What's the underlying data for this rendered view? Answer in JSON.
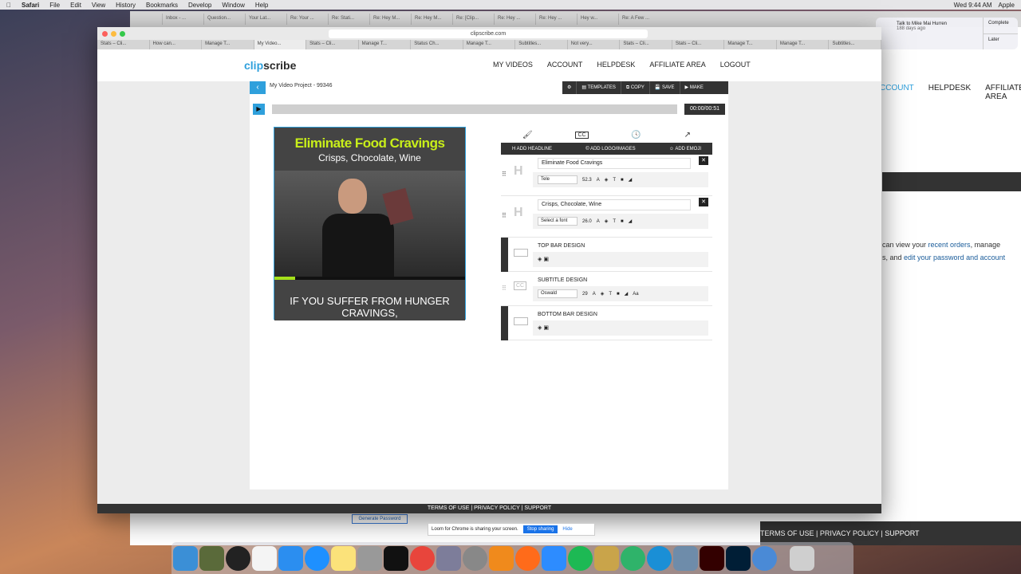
{
  "menubar": {
    "app": "Safari",
    "items": [
      "File",
      "Edit",
      "View",
      "History",
      "Bookmarks",
      "Develop",
      "Window",
      "Help"
    ],
    "clock": "Wed 9:44 AM",
    "user": "Apple"
  },
  "background_window": {
    "tabs": [
      "Inbox - ...",
      "Question...",
      "Your Lat...",
      "Re: Your ...",
      "Re: Stati...",
      "Re: Hey M...",
      "Re: Hey M...",
      "Re: [Clip...",
      "Re: Hey ...",
      "Re: Hey ...",
      "Hey w...",
      "Re: A Few ..."
    ],
    "nav": [
      "CCOUNT",
      "HELPDESK",
      "AFFILIATE AREA"
    ],
    "text_line1_pre": "can view your ",
    "text_line1_link": "recent orders",
    "text_line1_post": ", manage",
    "text_line2_pre": "s, and ",
    "text_line2_link": "edit your password and account",
    "footer": "TERMS OF USE | PRIVACY POLICY | SUPPORT",
    "generate_password": "Generate Password"
  },
  "notification": {
    "title": "Talk to Mike Mai Hurren",
    "subtitle": "188 days ago",
    "complete": "Complete",
    "later": "Later"
  },
  "browser": {
    "url": "clipscribe.com",
    "tabs": [
      "Stats – Cli...",
      "How can...",
      "Manage T...",
      "My Video...",
      "Stats – Cli...",
      "Manage T...",
      "Status Ch...",
      "Manage T...",
      "Subtitles...",
      "Not very...",
      "Stats – Cli...",
      "Stats – Cli...",
      "Manage T...",
      "Manage T...",
      "Subtitles..."
    ]
  },
  "site": {
    "logo_a": "clip",
    "logo_b": "scribe",
    "nav": [
      "MY VIDEOS",
      "ACCOUNT",
      "HELPDESK",
      "AFFILIATE AREA",
      "LOGOUT"
    ],
    "footer": "TERMS OF USE | PRIVACY POLICY | SUPPORT"
  },
  "editor": {
    "project_name": "My Video Project - 99346",
    "toolbar": [
      "TEMPLATES",
      "COPY",
      "SAVE",
      "MAKE"
    ],
    "timecode": "00:00/00:51",
    "progress_fraction": 0.11,
    "preview": {
      "headline": "Eliminate Food Cravings",
      "subheadline": "Crisps, Chocolate, Wine",
      "subtitle": "IF YOU SUFFER FROM HUNGER CRAVINGS,"
    },
    "add_buttons": [
      "ADD HEADLINE",
      "ADD LOGO/IMAGES",
      "ADD EMOJI"
    ],
    "layers": [
      {
        "text": "Eliminate Food Cravings",
        "font": "Tele",
        "size": "52.3"
      },
      {
        "text": "Crisps, Chocolate, Wine",
        "font": "Select a font",
        "size": "26.0"
      }
    ],
    "designs": {
      "top": "TOP BAR DESIGN",
      "subtitle": "SUBTITLE DESIGN",
      "subtitle_font": "Oswald",
      "subtitle_size": "29",
      "bottom": "BOTTOM BAR DESIGN"
    }
  },
  "share_bar": {
    "message": "Loom for Chrome is sharing your screen.",
    "stop": "Stop sharing",
    "hide": "Hide"
  },
  "colors": {
    "accent": "#2fa0dc",
    "headline": "#c8ee1a",
    "dark": "#333333"
  }
}
